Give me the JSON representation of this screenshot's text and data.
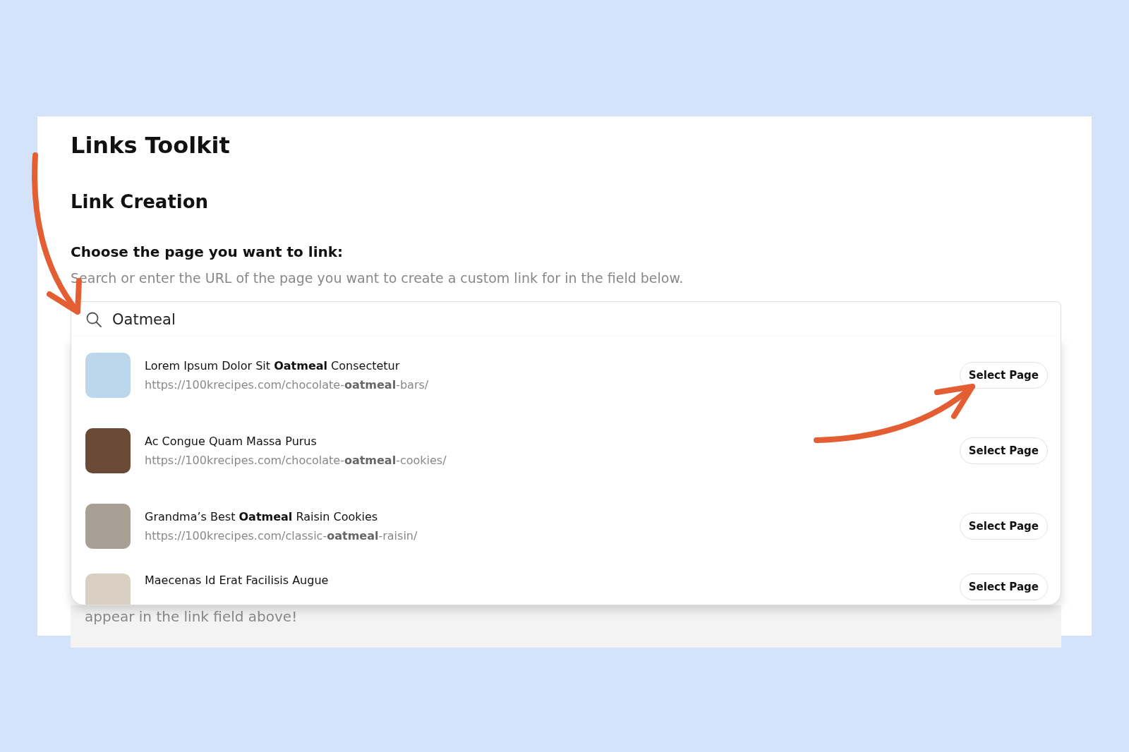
{
  "title": "Links Toolkit",
  "section_title": "Link Creation",
  "prompt": {
    "label": "Choose the page you want to link:",
    "hint": "Search or enter the URL of the page you want to create a custom link for in the field below."
  },
  "search": {
    "value": "Oatmeal"
  },
  "results": [
    {
      "title": "Lorem Ipsum Dolor Sit **Oatmeal** Consectetur",
      "url": "https://100krecipes.com/chocolate-**oatmeal**-bars/",
      "button": "Select Page"
    },
    {
      "title": "Ac Congue Quam Massa Purus",
      "url": "https://100krecipes.com/chocolate-**oatmeal**-cookies/",
      "button": "Select Page"
    },
    {
      "title": "Grandma’s Best **Oatmeal** Raisin Cookies",
      "url": "https://100krecipes.com/classic-**oatmeal**-raisin/",
      "button": "Select Page"
    },
    {
      "title": "Maecenas Id Erat Facilisis Augue",
      "button": "Select Page"
    }
  ],
  "behind_text": "appear in the link field above!"
}
